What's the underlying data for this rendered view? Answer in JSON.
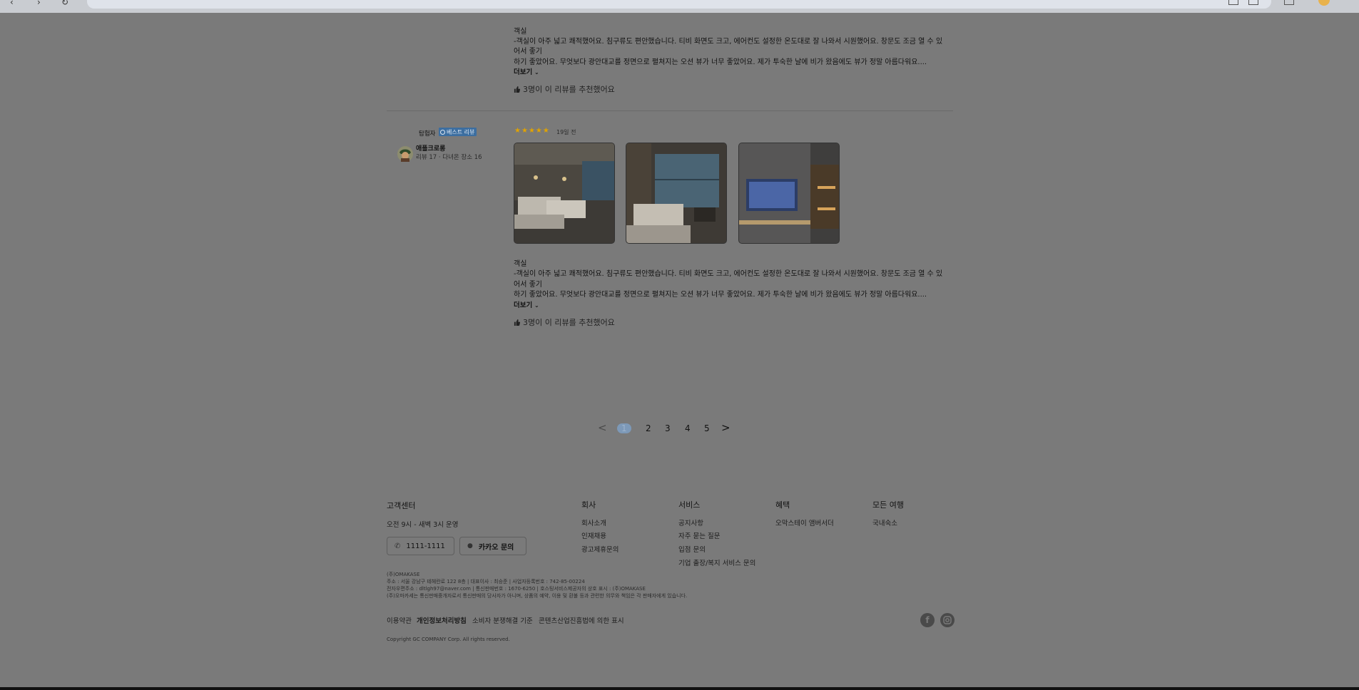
{
  "review1": {
    "text_lines": [
      "객실",
      "-객실이 아주 넓고 쾌적했어요. 침구류도 편안했습니다. 티비 화면도 크고, 에어컨도 설정한 온도대로 잘 나와서 시원했어요. 창문도 조금 열 수 있",
      "어서 좋기",
      "하기 좋았어요. 무엇보다 광안대교를 정면으로 펼쳐지는 오션 뷰가 너무 좋았어요. 제가 투숙한 날에 비가 왔음에도 뷰가 정말 아름다워요...."
    ],
    "more_label": "더보기",
    "recommend_text": "3명이 이 리뷰를 추천했어요"
  },
  "review2": {
    "reviewer_type": "탐험자",
    "badge_label": "베스트 리뷰",
    "reviewer_name": "애플크로롱",
    "reviewer_meta": "리뷰 17 · 다녀온 장소 16",
    "rating": 5,
    "time_ago": "19일 전",
    "photos": [
      "bedroom-twin-beds-photo",
      "bedroom-ocean-window-photo",
      "tv-wall-photo"
    ],
    "text_lines": [
      "객실",
      "-객실이 아주 넓고 쾌적했어요. 침구류도 편안했습니다. 티비 화면도 크고, 에어컨도 설정한 온도대로 잘 나와서 시원했어요. 창문도 조금 열 수 있",
      "어서 좋기",
      "하기 좋았어요. 무엇보다 광안대교를 정면으로 펼쳐지는 오션 뷰가 너무 좋았어요. 제가 투숙한 날에 비가 왔음에도 뷰가 정말 아름다워요...."
    ],
    "more_label": "더보기",
    "recommend_text": "3명이 이 리뷰를 추천했어요"
  },
  "pagination": {
    "prev": "<",
    "pages": [
      "1",
      "2",
      "3",
      "4",
      "5"
    ],
    "active_page": "1",
    "next": ">"
  },
  "footer": {
    "customer_center": {
      "title": "고객센터",
      "hours": "오전 9시 - 새벽 3시 운영",
      "phone": "1111-1111",
      "kakao": "카카오 문의"
    },
    "columns": [
      {
        "title": "회사",
        "links": [
          "회사소개",
          "인재채용",
          "광고제휴문의"
        ]
      },
      {
        "title": "서비스",
        "links": [
          "공지사항",
          "자주 묻는 질문",
          "입점 문의",
          "기업 출장/복지 서비스 문의"
        ]
      },
      {
        "title": "혜택",
        "links": [
          "오막스테이 앰버서더"
        ]
      },
      {
        "title": "모든 여행",
        "links": [
          "국내숙소"
        ]
      }
    ],
    "company_info": [
      "(주)OMAKASE",
      "주소 : 서울 강남구 테헤란로 122 8층 | 대표이사 : 최승준 | 사업자등록번호 : 742-85-00224",
      "전자우편주소 : dltlgh97@naver.com | 통신판매번호 : 1670-6250 | 호스팅서비스제공자의 상호 표시 : (주)OMAKASE",
      "(주)오마카세는 통신판매중개자로서 통신판매의 당사자가 아니며, 상품의 예약, 이용 및 환불 등과 관련한 의무와 책임은 각 판매자에게 있습니다."
    ],
    "legal_links": {
      "terms": "이용약관",
      "privacy": "개인정보처리방침",
      "consumer": "소비자 분쟁해결 기준",
      "content": "콘텐츠산업진흥법에 의한 표시"
    },
    "copyright": "Copyright GC COMPANY Corp. All rights reserved.",
    "social": [
      "facebook-icon",
      "instagram-icon"
    ]
  },
  "colors": {
    "overlay": "#7a7a7a",
    "badge": "#3c6ea0",
    "star": "#e0a300",
    "active_page": "#7d99b8"
  }
}
